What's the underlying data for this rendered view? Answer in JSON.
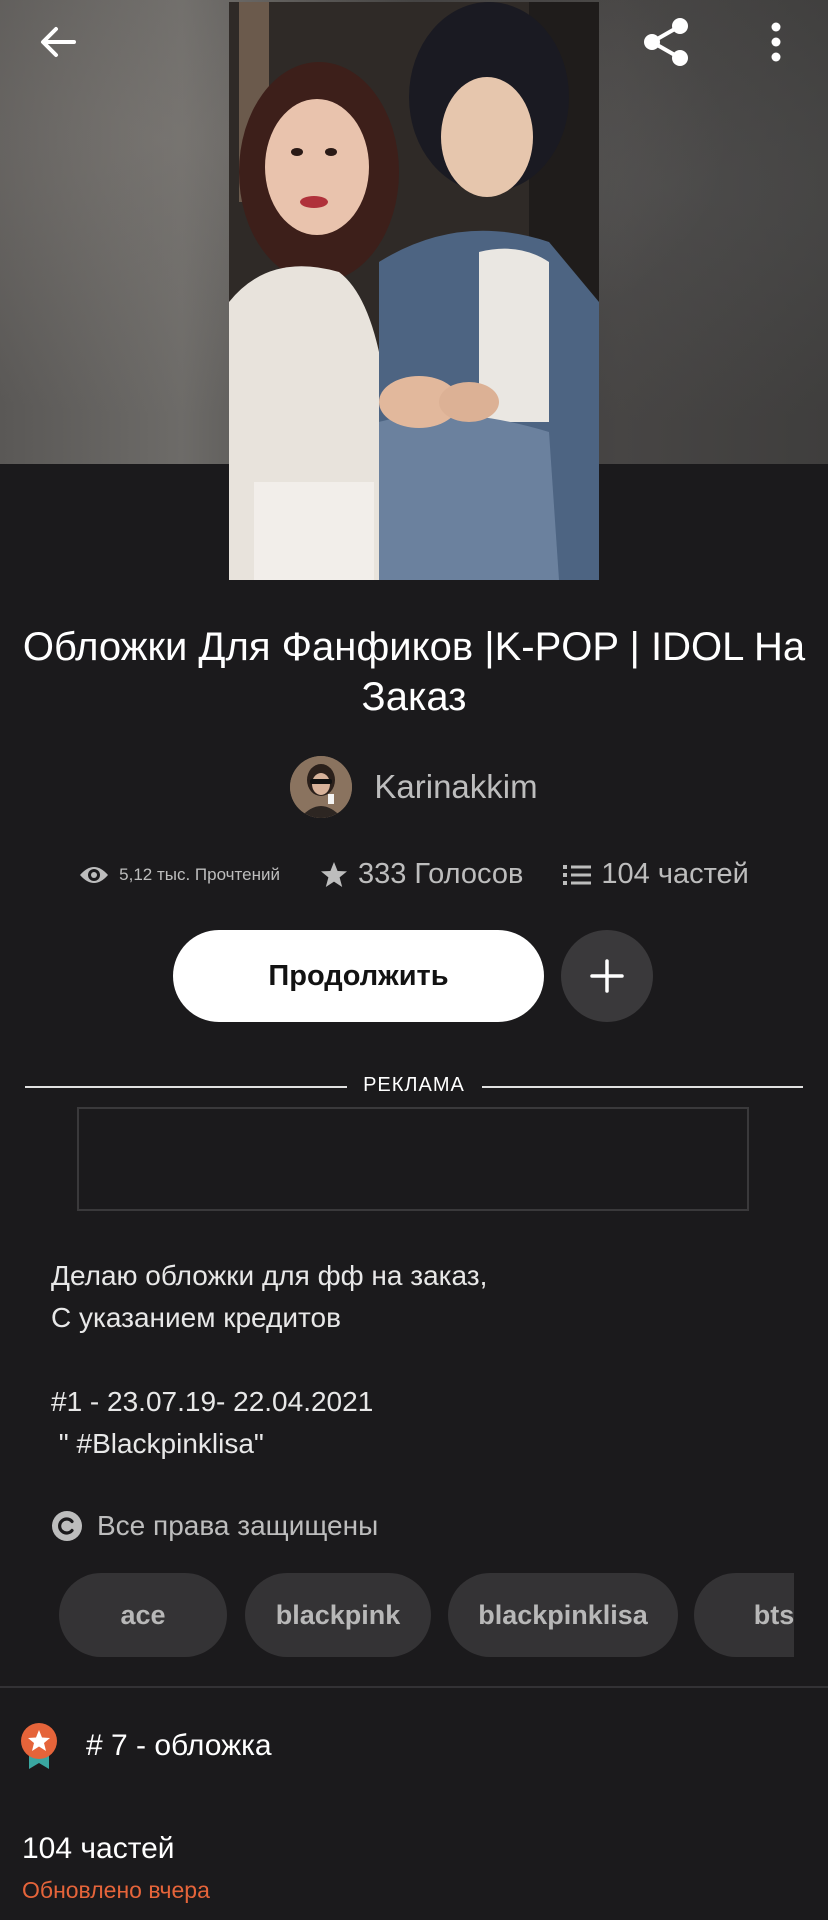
{
  "header": {
    "back_icon": "arrow-left-icon",
    "share_icon": "share-icon",
    "more_icon": "more-vertical-icon"
  },
  "story": {
    "title": "Обложки Для Фанфиков |K-POP | IDOL На Заказ",
    "author": "Karinakkim",
    "stats": {
      "reads": "5,12 тыс. Прочтений",
      "votes": "333 Голосов",
      "parts": "104 частей"
    },
    "continue_label": "Продолжить",
    "add_icon": "plus-icon"
  },
  "ad": {
    "label": "РЕКЛАМА"
  },
  "description": "Делаю обложки для фф на заказ,\nС указанием кредитов\n\n#1 - 23.07.19- 22.04.2021\n \" #Blackpinklisa\"",
  "copyright": {
    "icon": "copyright-icon",
    "text": "Все права защищены"
  },
  "tags": [
    "ace",
    "blackpink",
    "blackpinklisa",
    "bts"
  ],
  "ranking": {
    "icon": "ranking-badge-icon",
    "text": "# 7 - обложка"
  },
  "toc": {
    "parts_count": "104 частей",
    "updated": "Обновлено вчера"
  },
  "colors": {
    "background": "#1b1a1c",
    "accent_orange": "#e5643a",
    "button_white": "#ffffff",
    "tag_bg": "#343335"
  }
}
